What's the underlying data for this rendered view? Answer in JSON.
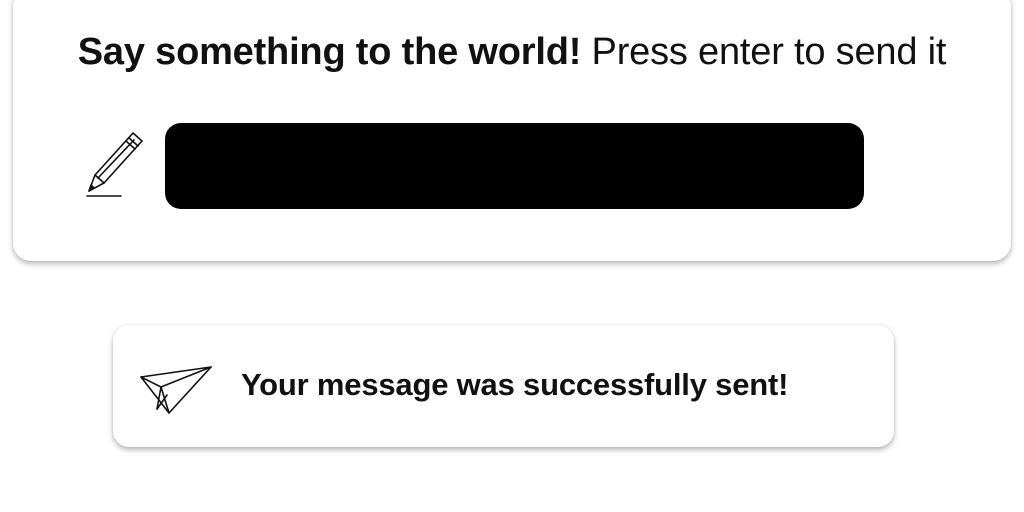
{
  "compose": {
    "heading_bold": "Say something to the world!",
    "heading_regular": "Press enter to send it",
    "input_value": "",
    "pencil_icon": "pencil-icon"
  },
  "toast": {
    "message": "Your message was successfully sent!",
    "plane_icon": "paper-plane-icon"
  },
  "colors": {
    "input_background": "#000000",
    "card_background": "#ffffff",
    "text": "#111111"
  }
}
